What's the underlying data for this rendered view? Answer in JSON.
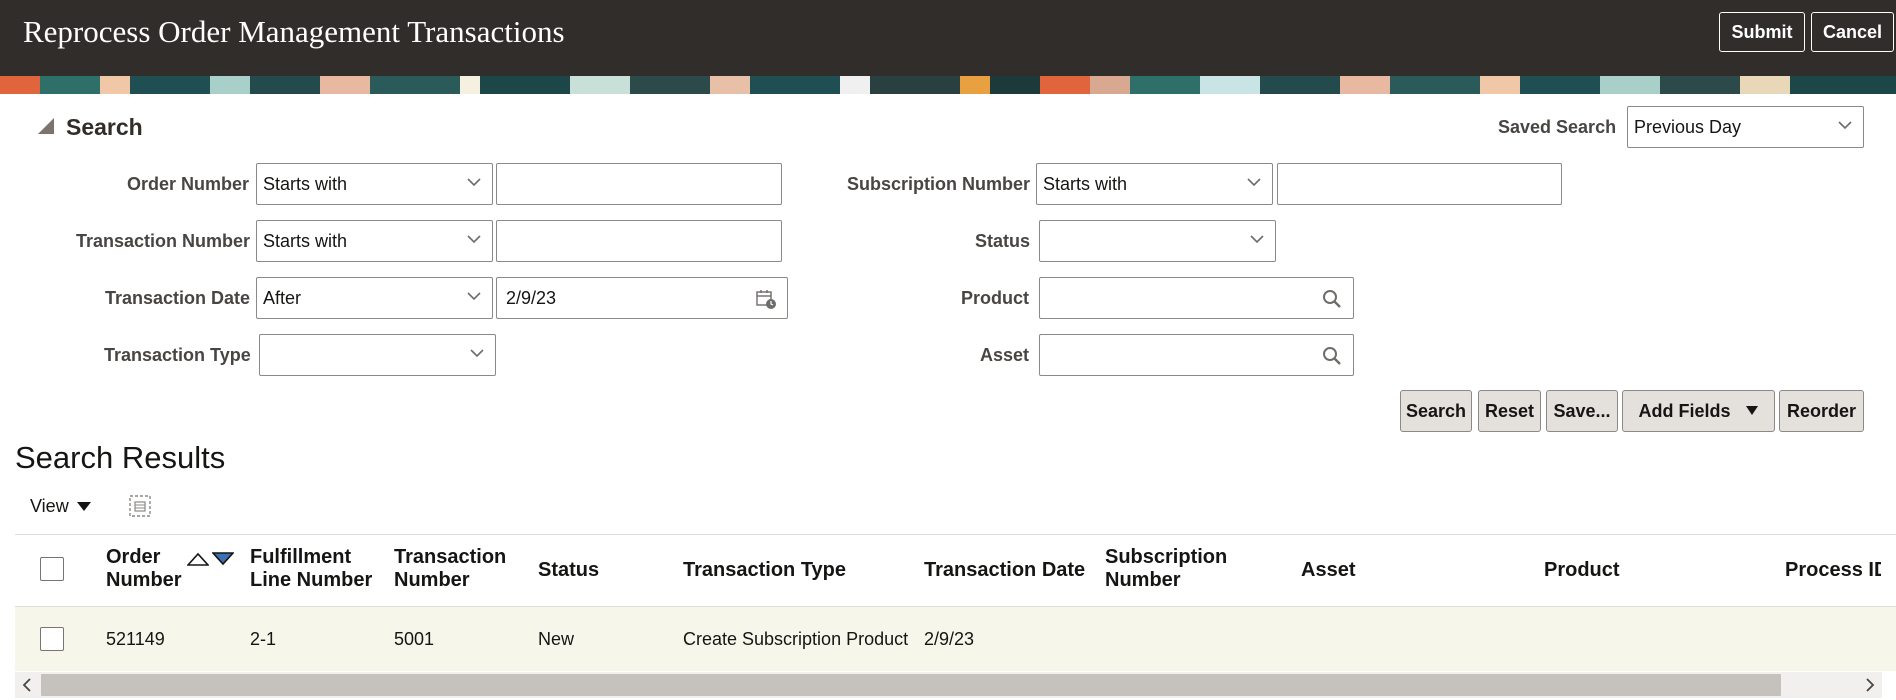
{
  "header": {
    "title": "Reprocess Order Management Transactions",
    "submit_label": "Submit",
    "cancel_label": "Cancel"
  },
  "search": {
    "title": "Search",
    "saved_search_label": "Saved Search",
    "saved_search_value": "Previous Day",
    "fields": {
      "order_number": {
        "label": "Order Number",
        "operator": "Starts with",
        "value": ""
      },
      "transaction_number": {
        "label": "Transaction Number",
        "operator": "Starts with",
        "value": ""
      },
      "transaction_date": {
        "label": "Transaction Date",
        "operator": "After",
        "value": "2/9/23"
      },
      "transaction_type": {
        "label": "Transaction Type",
        "value": ""
      },
      "subscription_number": {
        "label": "Subscription Number",
        "operator": "Starts with",
        "value": ""
      },
      "status": {
        "label": "Status",
        "value": ""
      },
      "product": {
        "label": "Product",
        "value": ""
      },
      "asset": {
        "label": "Asset",
        "value": ""
      }
    },
    "buttons": {
      "search": "Search",
      "reset": "Reset",
      "save": "Save...",
      "add_fields": "Add Fields",
      "reorder": "Reorder"
    }
  },
  "results": {
    "title": "Search Results",
    "view_label": "View",
    "columns": {
      "order_number": [
        "Order",
        "Number"
      ],
      "fulfillment_line_number": [
        "Fulfillment",
        "Line Number"
      ],
      "transaction_number": [
        "Transaction",
        "Number"
      ],
      "status": "Status",
      "transaction_type": "Transaction Type",
      "transaction_date": "Transaction Date",
      "subscription_number": [
        "Subscription",
        "Number"
      ],
      "asset": "Asset",
      "product": "Product",
      "process_id": "Process ID"
    },
    "rows": [
      {
        "order_number": "521149",
        "fulfillment_line_number": "2-1",
        "transaction_number": "5001",
        "status": "New",
        "transaction_type": "Create Subscription Product",
        "transaction_date": "2/9/23",
        "subscription_number": "",
        "asset": "",
        "product": "",
        "process_id": ""
      }
    ]
  },
  "colors": {
    "header_bg": "#312d2a",
    "button_bg": "#e4e1dd",
    "row_highlight": "#f6f6ea",
    "sort_desc_active": "#3b6fb6"
  }
}
